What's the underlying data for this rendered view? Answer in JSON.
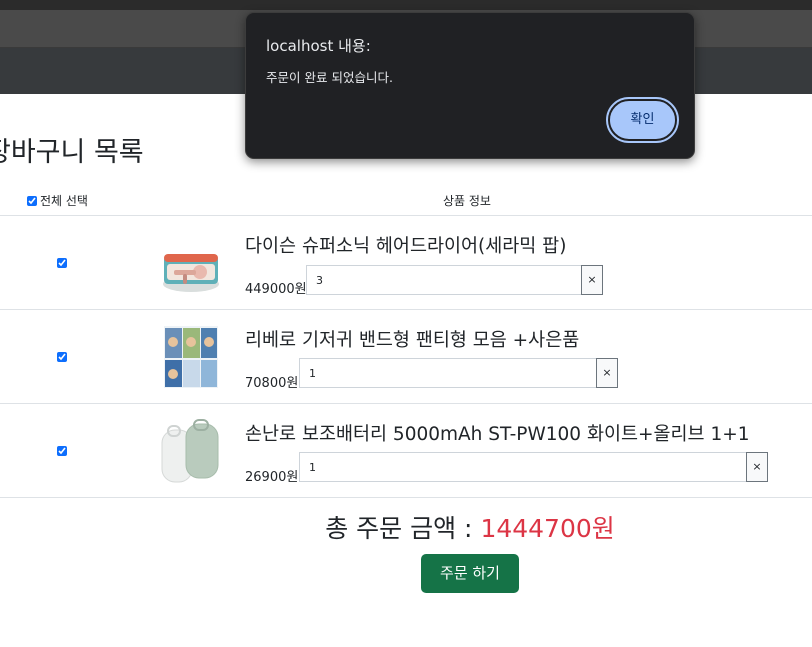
{
  "page": {
    "title": "장바구니 목록"
  },
  "table": {
    "select_all_label": "전체 선택",
    "info_header": "상품 정보"
  },
  "items": [
    {
      "name": "다이슨 슈퍼소닉 헤어드라이어(세라믹 팝)",
      "price": "449000원",
      "quantity": "3",
      "checked": true,
      "remove_label": "×"
    },
    {
      "name": "리베로 기저귀 밴드형 팬티형 모음 +사은품",
      "price": "70800원",
      "quantity": "1",
      "checked": true,
      "remove_label": "×"
    },
    {
      "name": "손난로 보조배터리 5000mAh ST-PW100 화이트+올리브 1+1",
      "price": "26900원",
      "quantity": "1",
      "checked": true,
      "remove_label": "×"
    }
  ],
  "summary": {
    "label": "총 주문 금액 : ",
    "amount": "1444700원",
    "order_button": "주문 하기"
  },
  "alert": {
    "title": "localhost 내용:",
    "message": "주문이 완료 되었습니다.",
    "ok_label": "확인"
  },
  "colors": {
    "total_amount": "#dc3545",
    "order_button": "#157347",
    "dialog_bg": "#202124",
    "dialog_button": "#a8c7fa"
  }
}
